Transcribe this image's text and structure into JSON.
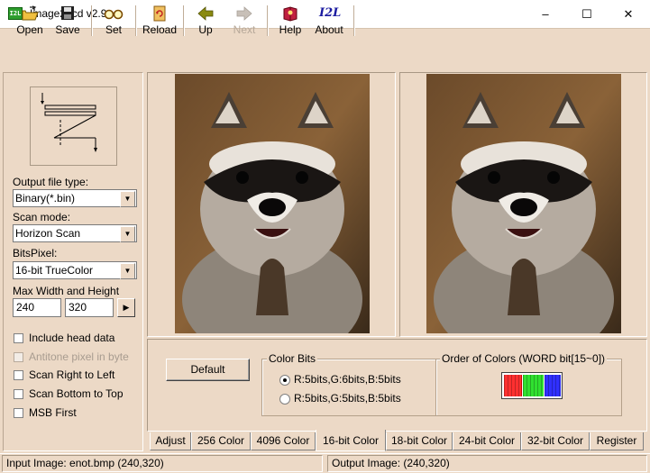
{
  "window": {
    "title": "Image2Lcd v2.9",
    "icon_label": "I2L",
    "controls": {
      "minimize": "–",
      "maximize": "☐",
      "close": "✕"
    }
  },
  "toolbar": {
    "buttons": [
      {
        "label": "Open",
        "icon": "open-folder-icon"
      },
      {
        "label": "Save",
        "icon": "floppy-disk-icon"
      },
      {
        "label": "Set",
        "icon": "glasses-icon"
      },
      {
        "label": "Reload",
        "icon": "reload-icon"
      },
      {
        "label": "Up",
        "icon": "arrow-left-icon"
      },
      {
        "label": "Next",
        "icon": "arrow-right-icon",
        "disabled": true
      },
      {
        "label": "Help",
        "icon": "help-book-icon"
      },
      {
        "label": "About",
        "icon": "i2l-logo-icon",
        "icon_text": "I2L"
      }
    ]
  },
  "settings": {
    "output_type_label": "Output file type:",
    "output_type_value": "Binary(*.bin)",
    "scan_mode_label": "Scan mode:",
    "scan_mode_value": "Horizon Scan",
    "bits_pixel_label": "BitsPixel:",
    "bits_pixel_value": "16-bit TrueColor",
    "max_size_label": "Max Width and Height",
    "max_width": "240",
    "max_height": "320",
    "spin_arrow": "▶",
    "options": [
      {
        "label": "Include head data",
        "checked": false,
        "disabled": false
      },
      {
        "label": "Antitone pixel in byte",
        "checked": false,
        "disabled": true
      },
      {
        "label": "Scan Right to Left",
        "checked": false,
        "disabled": false
      },
      {
        "label": "Scan Bottom to Top",
        "checked": false,
        "disabled": false
      },
      {
        "label": "MSB First",
        "checked": false,
        "disabled": false
      }
    ]
  },
  "lower": {
    "default_button": "Default",
    "color_bits_title": "Color Bits",
    "radio_options": [
      {
        "label": "R:5bits,G:6bits,B:5bits",
        "selected": true
      },
      {
        "label": "R:5bits,G:5bits,B:5bits",
        "selected": false
      }
    ],
    "order_title": "Order of Colors (WORD bit[15~0])",
    "order_colors": [
      "#ff3030",
      "#30e030",
      "#3030ff"
    ]
  },
  "tabs": [
    {
      "label": "Adjust",
      "active": false
    },
    {
      "label": "256 Color",
      "active": false
    },
    {
      "label": "4096 Color",
      "active": false
    },
    {
      "label": "16-bit Color",
      "active": true
    },
    {
      "label": "18-bit Color",
      "active": false
    },
    {
      "label": "24-bit Color",
      "active": false
    },
    {
      "label": "32-bit Color",
      "active": false
    },
    {
      "label": "Register",
      "active": false
    }
  ],
  "status": {
    "input_image": "Input Image: enot.bmp (240,320)",
    "output_image": "Output Image: (240,320)"
  }
}
